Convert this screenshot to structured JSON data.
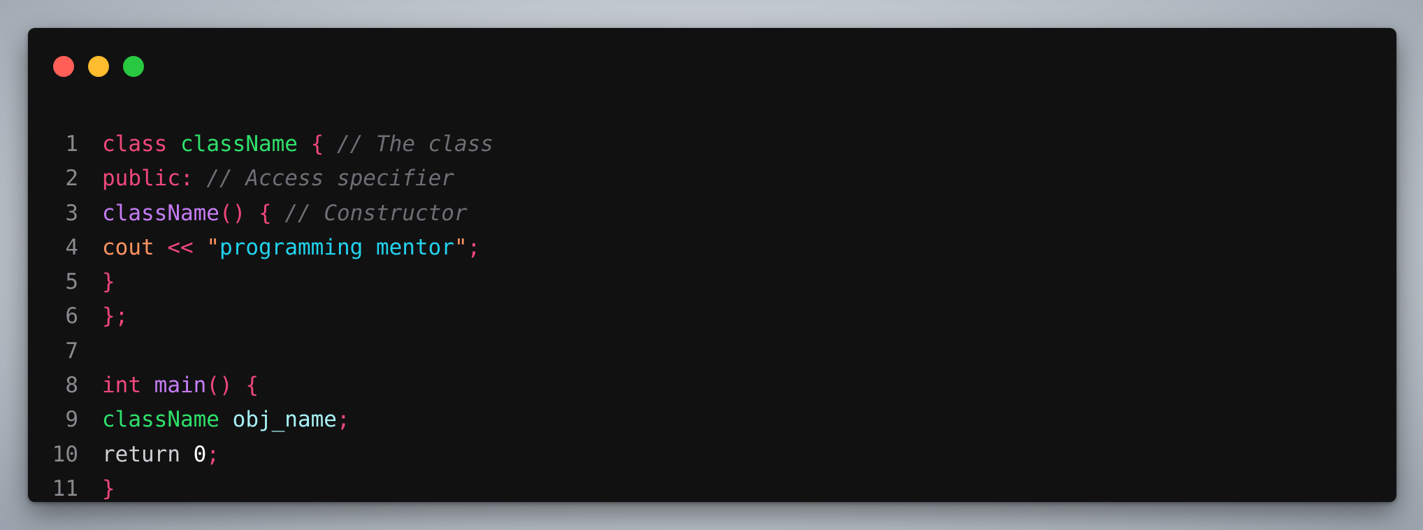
{
  "window": {
    "controls": [
      {
        "name": "close-dot",
        "color": "#ff5f57"
      },
      {
        "name": "minimize-dot",
        "color": "#febc2e"
      },
      {
        "name": "maximize-dot",
        "color": "#28c840"
      }
    ]
  },
  "colors": {
    "keyword": "#f0487a",
    "type": "#2fe06a",
    "function": "#c57cf5",
    "comment": "#6e6e74",
    "punct": "#f0487a",
    "identifier_orange": "#ff9460",
    "string": "#22d3ee",
    "variable": "#a8f1f5",
    "plain": "#cfcfd3",
    "number": "#ffffff",
    "line_number": "#8a8a8f"
  },
  "lines": [
    {
      "num": "1",
      "tokens": [
        {
          "text": "class",
          "color": "#f0487a"
        },
        {
          "text": " ",
          "color": "#cfcfd3"
        },
        {
          "text": "className",
          "color": "#2fe06a"
        },
        {
          "text": " ",
          "color": "#cfcfd3"
        },
        {
          "text": "{",
          "color": "#f0487a"
        },
        {
          "text": " ",
          "color": "#cfcfd3"
        },
        {
          "text": "// The class",
          "color": "#6e6e74",
          "italic": true
        }
      ]
    },
    {
      "num": "2",
      "tokens": [
        {
          "text": "public:",
          "color": "#f0487a"
        },
        {
          "text": " ",
          "color": "#cfcfd3"
        },
        {
          "text": "// Access specifier",
          "color": "#6e6e74",
          "italic": true
        }
      ]
    },
    {
      "num": "3",
      "tokens": [
        {
          "text": "className",
          "color": "#c57cf5"
        },
        {
          "text": "()",
          "color": "#f0487a"
        },
        {
          "text": " ",
          "color": "#cfcfd3"
        },
        {
          "text": "{",
          "color": "#f0487a"
        },
        {
          "text": " ",
          "color": "#cfcfd3"
        },
        {
          "text": "// Constructor",
          "color": "#6e6e74",
          "italic": true
        }
      ]
    },
    {
      "num": "4",
      "tokens": [
        {
          "text": "cout",
          "color": "#ff9460"
        },
        {
          "text": " ",
          "color": "#cfcfd3"
        },
        {
          "text": "<<",
          "color": "#f0487a"
        },
        {
          "text": " ",
          "color": "#cfcfd3"
        },
        {
          "text": "\"",
          "color": "#ff9460"
        },
        {
          "text": "programming mentor",
          "color": "#22d3ee"
        },
        {
          "text": "\"",
          "color": "#ff9460"
        },
        {
          "text": ";",
          "color": "#f0487a"
        }
      ]
    },
    {
      "num": "5",
      "tokens": [
        {
          "text": "}",
          "color": "#f0487a"
        }
      ]
    },
    {
      "num": "6",
      "tokens": [
        {
          "text": "};",
          "color": "#f0487a"
        }
      ]
    },
    {
      "num": "7",
      "tokens": []
    },
    {
      "num": "8",
      "tokens": [
        {
          "text": "int",
          "color": "#f0487a"
        },
        {
          "text": " ",
          "color": "#cfcfd3"
        },
        {
          "text": "main",
          "color": "#c57cf5"
        },
        {
          "text": "()",
          "color": "#f0487a"
        },
        {
          "text": " ",
          "color": "#cfcfd3"
        },
        {
          "text": "{",
          "color": "#f0487a"
        }
      ]
    },
    {
      "num": "9",
      "tokens": [
        {
          "text": "className",
          "color": "#2fe06a"
        },
        {
          "text": " ",
          "color": "#cfcfd3"
        },
        {
          "text": "obj_name",
          "color": "#a8f1f5"
        },
        {
          "text": ";",
          "color": "#f0487a"
        }
      ]
    },
    {
      "num": "10",
      "tokens": [
        {
          "text": "return",
          "color": "#cfcfd3"
        },
        {
          "text": " ",
          "color": "#cfcfd3"
        },
        {
          "text": "0",
          "color": "#ffffff"
        },
        {
          "text": ";",
          "color": "#f0487a"
        }
      ]
    },
    {
      "num": "11",
      "tokens": [
        {
          "text": "}",
          "color": "#f0487a"
        }
      ]
    }
  ]
}
